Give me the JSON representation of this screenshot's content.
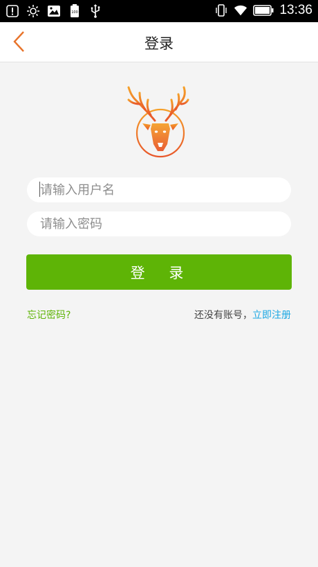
{
  "status_bar": {
    "time": "13:36",
    "left_icons": [
      "alert-icon",
      "brightness-icon",
      "image-icon",
      "battery-saver-icon",
      "usb-icon"
    ],
    "right_icons": [
      "vibrate-icon",
      "wifi-icon",
      "battery-icon"
    ]
  },
  "header": {
    "title": "登录",
    "back_icon": "chevron-left-icon",
    "accent_color": "#e8732a"
  },
  "logo": {
    "icon": "deer-logo-icon",
    "color": "#f07a1e"
  },
  "form": {
    "username_placeholder": "请输入用户名",
    "password_placeholder": "请输入密码",
    "login_label": "登 录",
    "login_color": "#5eb406"
  },
  "links": {
    "forgot_password": "忘记密码?",
    "no_account_text": "还没有账号，",
    "register_now": "立即注册",
    "forgot_color": "#5eb406",
    "register_color": "#1aa7e3"
  }
}
